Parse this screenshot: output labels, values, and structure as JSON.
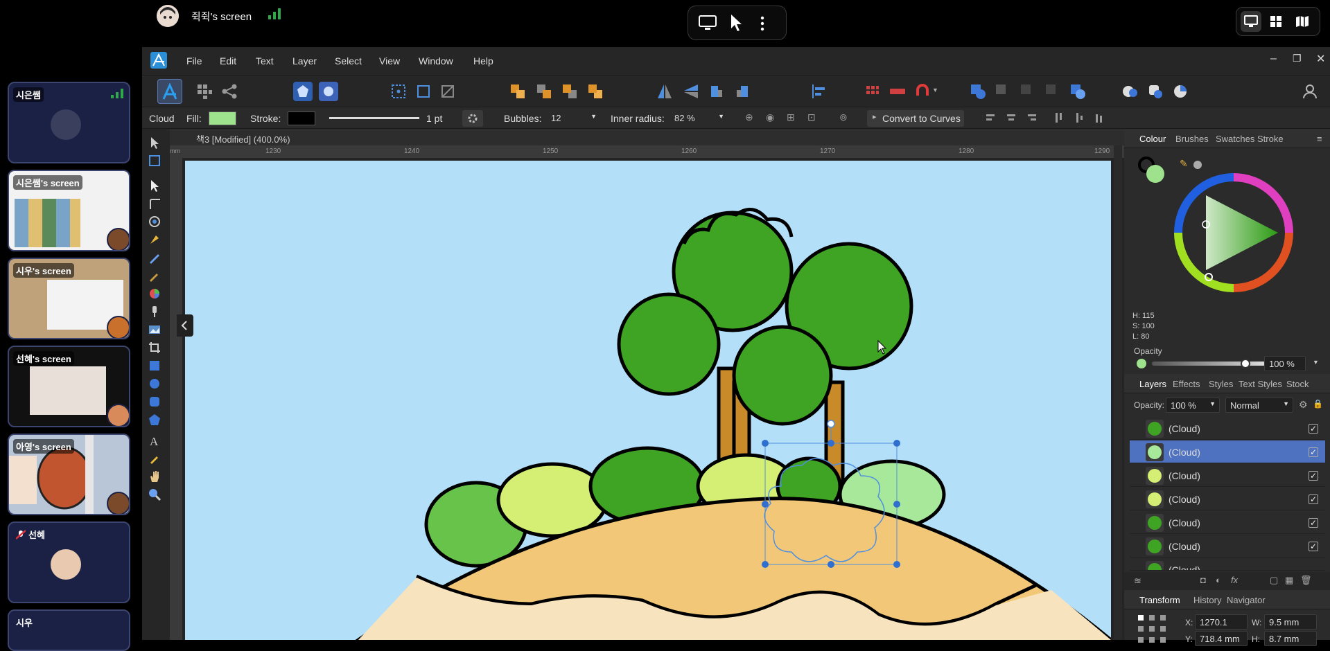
{
  "meeting": {
    "share_title": "쥑쥑's screen",
    "tiles": [
      {
        "name": "시은쌤"
      },
      {
        "name": "시은쌤's screen"
      },
      {
        "name": "시우's screen"
      },
      {
        "name": "선혜's screen"
      },
      {
        "name": "아영's screen"
      },
      {
        "name": "선혜"
      },
      {
        "name": "시우"
      }
    ]
  },
  "menu": [
    "File",
    "Edit",
    "Text",
    "Layer",
    "Select",
    "View",
    "Window",
    "Help"
  ],
  "context": {
    "shape_name": "Cloud",
    "fill_label": "Fill:",
    "stroke_label": "Stroke:",
    "stroke_width": "1 pt",
    "bubbles_label": "Bubbles:",
    "bubbles_value": "12",
    "inner_radius_label": "Inner radius:",
    "inner_radius_value": "82 %",
    "convert_label": "Convert to Curves"
  },
  "document": {
    "tab_title": "책3 [Modified] (400.0%)",
    "ruler_ticks": [
      "1230",
      "1240",
      "1250",
      "1260",
      "1270",
      "1280",
      "1290"
    ]
  },
  "colour_panel": {
    "tabs": [
      "Colour",
      "Brushes",
      "Swatches",
      "Stroke"
    ],
    "h": "H: 115",
    "s": "S: 100",
    "l": "L: 80",
    "opacity_label": "Opacity",
    "opacity_value": "100 %"
  },
  "layers_panel": {
    "tabs": [
      "Layers",
      "Effects",
      "Styles",
      "Text Styles",
      "Stock"
    ],
    "opacity_label": "Opacity:",
    "opacity_value": "100 %",
    "blend_mode": "Normal",
    "rows": [
      {
        "label": "(Cloud)",
        "selected": false,
        "thumb": "#3fa323"
      },
      {
        "label": "(Cloud)",
        "selected": true,
        "thumb": "#a8e89a"
      },
      {
        "label": "(Cloud)",
        "selected": false,
        "thumb": "#d4ef74"
      },
      {
        "label": "(Cloud)",
        "selected": false,
        "thumb": "#d4ef74"
      },
      {
        "label": "(Cloud)",
        "selected": false,
        "thumb": "#3fa323"
      },
      {
        "label": "(Cloud)",
        "selected": false,
        "thumb": "#3fa323"
      },
      {
        "label": "(Cloud)",
        "selected": false,
        "thumb": "#3fa323"
      }
    ]
  },
  "transform_panel": {
    "tabs": [
      "Transform",
      "History",
      "Navigator"
    ],
    "x_label": "X:",
    "x_value": "1270.1 mm",
    "y_label": "Y:",
    "y_value": "718.4 mm",
    "w_label": "W:",
    "w_value": "9.5 mm",
    "h_label": "H:",
    "h_value": "8.7 mm"
  },
  "colors": {
    "fill": "#9fe28e",
    "stroke": "#000000",
    "sky": "#b3dff8",
    "selection": "#4e71c0",
    "accent_green": "#2ea84a"
  }
}
